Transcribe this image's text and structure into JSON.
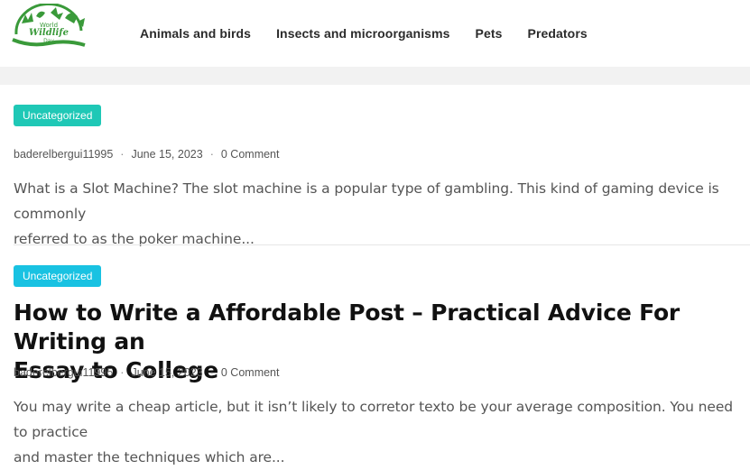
{
  "logo": {
    "line1": "World",
    "line2": "Wildlife",
    "line3": "Day",
    "color": "#3a9a3a"
  },
  "nav": {
    "items": [
      {
        "label": "Animals and birds"
      },
      {
        "label": "Insects and microorganisms"
      },
      {
        "label": "Pets"
      },
      {
        "label": "Predators"
      }
    ]
  },
  "posts": [
    {
      "category": "Uncategorized",
      "category_color": "#1fc8b6",
      "author": "baderelbergui11995",
      "date": "June 15, 2023",
      "comments": "0 Comment",
      "excerpt_line1": "What is a Slot Machine? The slot machine is a popular type of gambling. This kind of gaming device is commonly",
      "excerpt_line2": "referred to as the poker machine..."
    },
    {
      "category": "Uncategorized",
      "category_color": "#19c2e2",
      "title_line1": "How to Write a Affordable Post – Practical Advice For Writing an",
      "title_line2": "Essay to College",
      "author": "baderelbergui11995",
      "date": "June 15, 2023",
      "comments": "0 Comment",
      "excerpt_line1": "You may write a cheap article, but it isn’t likely to corretor texto be your average composition. You need to practice",
      "excerpt_line2": "and master the techniques which are..."
    }
  ]
}
